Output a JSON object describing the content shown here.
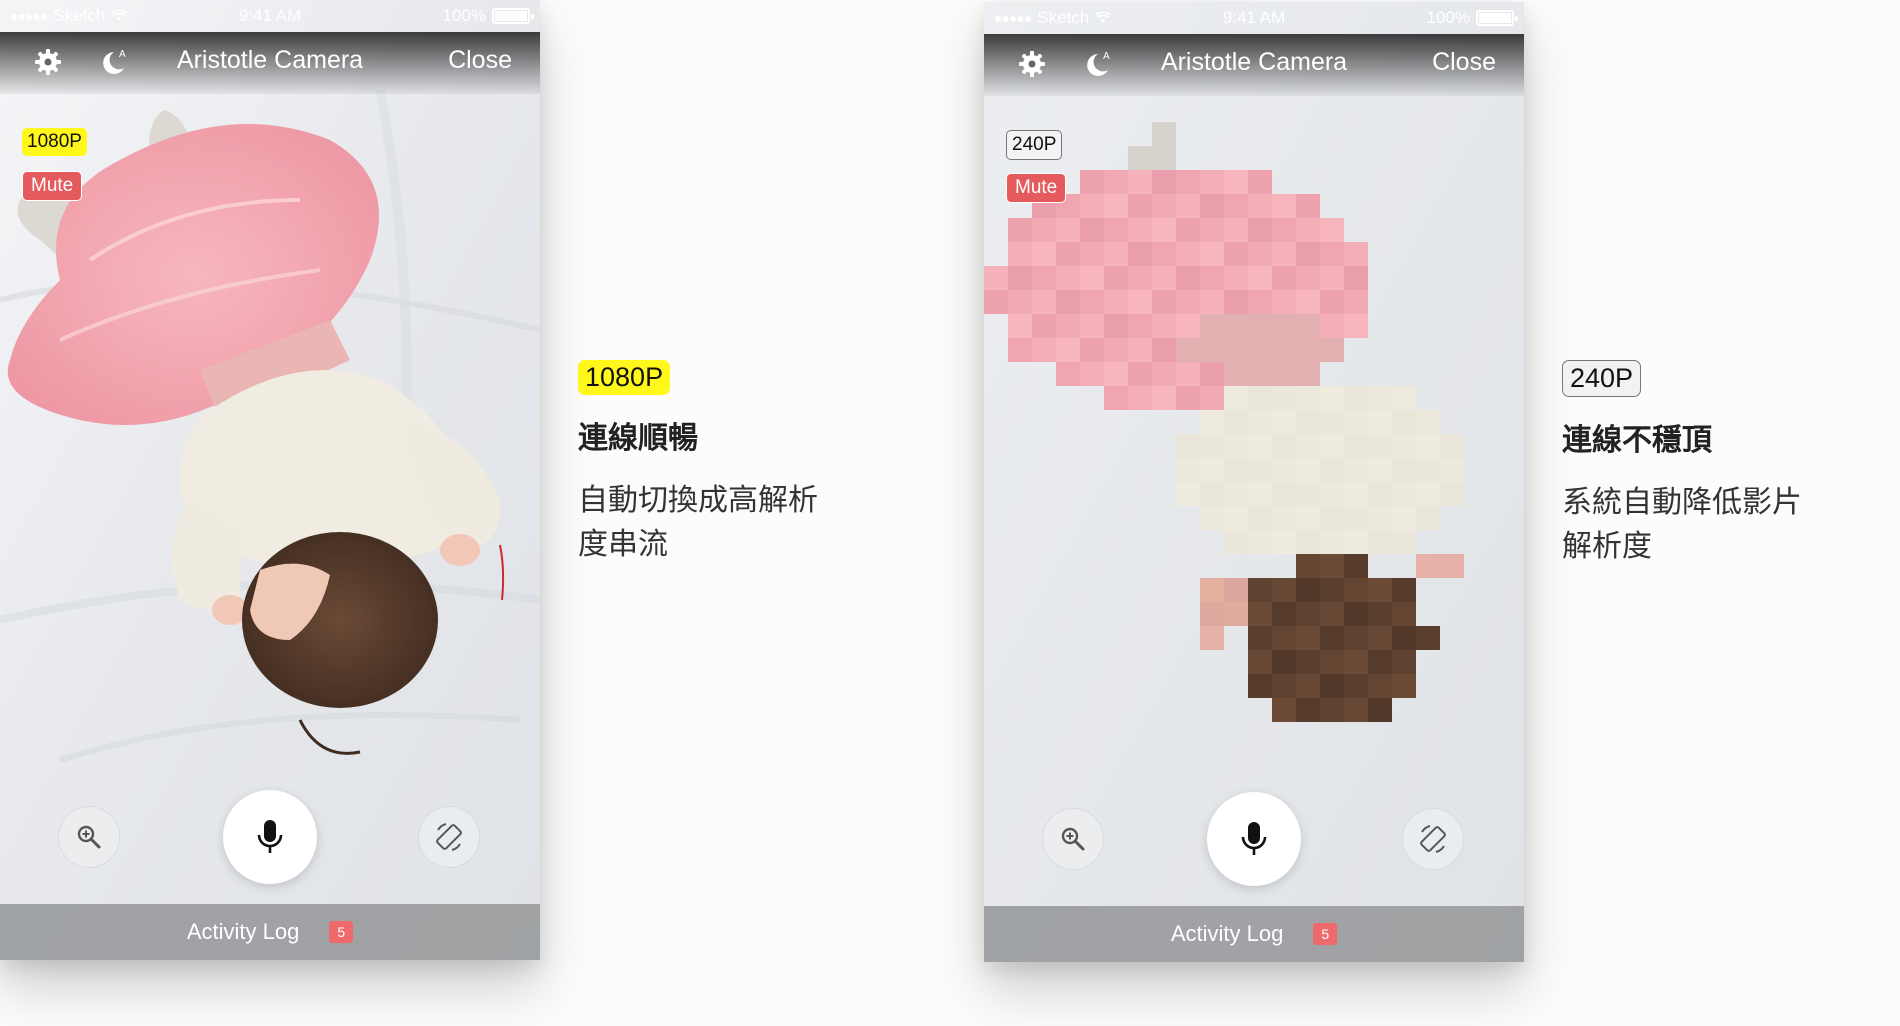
{
  "colors": {
    "hd_badge": "#fff81a",
    "mute_badge": "#e55a5c",
    "activity_count": "#ef6a6c",
    "background": "#fcfcfa"
  },
  "screens": [
    {
      "status": {
        "carrier": "Sketch",
        "time": "9:41 AM",
        "battery": "100%"
      },
      "nav": {
        "settings_icon": "gear-icon",
        "night_icon": "moon-auto-icon",
        "title": "Aristotle Camera",
        "close_label": "Close"
      },
      "resolution_badge": "1080P",
      "mute_badge": "Mute",
      "controls": {
        "zoom_icon": "zoom-in-icon",
        "mic_icon": "microphone-icon",
        "rotate_icon": "rotate-screen-icon"
      },
      "activity": {
        "label": "Activity Log",
        "count": "5"
      },
      "feed_quality": "sharp"
    },
    {
      "status": {
        "carrier": "Sketch",
        "time": "9:41 AM",
        "battery": "100%"
      },
      "nav": {
        "settings_icon": "gear-icon",
        "night_icon": "moon-auto-icon",
        "title": "Aristotle Camera",
        "close_label": "Close"
      },
      "resolution_badge": "240P",
      "mute_badge": "Mute",
      "controls": {
        "zoom_icon": "zoom-in-icon",
        "mic_icon": "microphone-icon",
        "rotate_icon": "rotate-screen-icon"
      },
      "activity": {
        "label": "Activity Log",
        "count": "5"
      },
      "feed_quality": "pixelated"
    }
  ],
  "captions": [
    {
      "badge": "1080P",
      "heading": "連線順暢",
      "body_lines": [
        "自動切換成高解析",
        "度串流"
      ]
    },
    {
      "badge": "240P",
      "heading": "連線不穩頂",
      "body_lines": [
        "系統自動降低影片",
        "解析度"
      ]
    }
  ]
}
